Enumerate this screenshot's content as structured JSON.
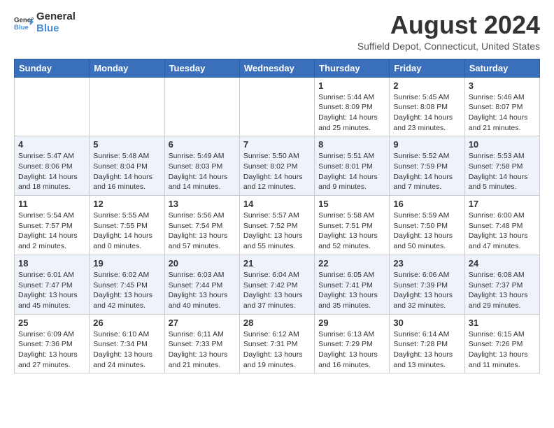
{
  "header": {
    "logo_line1": "General",
    "logo_line2": "Blue",
    "month": "August 2024",
    "location": "Suffield Depot, Connecticut, United States"
  },
  "weekdays": [
    "Sunday",
    "Monday",
    "Tuesday",
    "Wednesday",
    "Thursday",
    "Friday",
    "Saturday"
  ],
  "weeks": [
    [
      {
        "day": "",
        "info": ""
      },
      {
        "day": "",
        "info": ""
      },
      {
        "day": "",
        "info": ""
      },
      {
        "day": "",
        "info": ""
      },
      {
        "day": "1",
        "info": "Sunrise: 5:44 AM\nSunset: 8:09 PM\nDaylight: 14 hours\nand 25 minutes."
      },
      {
        "day": "2",
        "info": "Sunrise: 5:45 AM\nSunset: 8:08 PM\nDaylight: 14 hours\nand 23 minutes."
      },
      {
        "day": "3",
        "info": "Sunrise: 5:46 AM\nSunset: 8:07 PM\nDaylight: 14 hours\nand 21 minutes."
      }
    ],
    [
      {
        "day": "4",
        "info": "Sunrise: 5:47 AM\nSunset: 8:06 PM\nDaylight: 14 hours\nand 18 minutes."
      },
      {
        "day": "5",
        "info": "Sunrise: 5:48 AM\nSunset: 8:04 PM\nDaylight: 14 hours\nand 16 minutes."
      },
      {
        "day": "6",
        "info": "Sunrise: 5:49 AM\nSunset: 8:03 PM\nDaylight: 14 hours\nand 14 minutes."
      },
      {
        "day": "7",
        "info": "Sunrise: 5:50 AM\nSunset: 8:02 PM\nDaylight: 14 hours\nand 12 minutes."
      },
      {
        "day": "8",
        "info": "Sunrise: 5:51 AM\nSunset: 8:01 PM\nDaylight: 14 hours\nand 9 minutes."
      },
      {
        "day": "9",
        "info": "Sunrise: 5:52 AM\nSunset: 7:59 PM\nDaylight: 14 hours\nand 7 minutes."
      },
      {
        "day": "10",
        "info": "Sunrise: 5:53 AM\nSunset: 7:58 PM\nDaylight: 14 hours\nand 5 minutes."
      }
    ],
    [
      {
        "day": "11",
        "info": "Sunrise: 5:54 AM\nSunset: 7:57 PM\nDaylight: 14 hours\nand 2 minutes."
      },
      {
        "day": "12",
        "info": "Sunrise: 5:55 AM\nSunset: 7:55 PM\nDaylight: 14 hours\nand 0 minutes."
      },
      {
        "day": "13",
        "info": "Sunrise: 5:56 AM\nSunset: 7:54 PM\nDaylight: 13 hours\nand 57 minutes."
      },
      {
        "day": "14",
        "info": "Sunrise: 5:57 AM\nSunset: 7:52 PM\nDaylight: 13 hours\nand 55 minutes."
      },
      {
        "day": "15",
        "info": "Sunrise: 5:58 AM\nSunset: 7:51 PM\nDaylight: 13 hours\nand 52 minutes."
      },
      {
        "day": "16",
        "info": "Sunrise: 5:59 AM\nSunset: 7:50 PM\nDaylight: 13 hours\nand 50 minutes."
      },
      {
        "day": "17",
        "info": "Sunrise: 6:00 AM\nSunset: 7:48 PM\nDaylight: 13 hours\nand 47 minutes."
      }
    ],
    [
      {
        "day": "18",
        "info": "Sunrise: 6:01 AM\nSunset: 7:47 PM\nDaylight: 13 hours\nand 45 minutes."
      },
      {
        "day": "19",
        "info": "Sunrise: 6:02 AM\nSunset: 7:45 PM\nDaylight: 13 hours\nand 42 minutes."
      },
      {
        "day": "20",
        "info": "Sunrise: 6:03 AM\nSunset: 7:44 PM\nDaylight: 13 hours\nand 40 minutes."
      },
      {
        "day": "21",
        "info": "Sunrise: 6:04 AM\nSunset: 7:42 PM\nDaylight: 13 hours\nand 37 minutes."
      },
      {
        "day": "22",
        "info": "Sunrise: 6:05 AM\nSunset: 7:41 PM\nDaylight: 13 hours\nand 35 minutes."
      },
      {
        "day": "23",
        "info": "Sunrise: 6:06 AM\nSunset: 7:39 PM\nDaylight: 13 hours\nand 32 minutes."
      },
      {
        "day": "24",
        "info": "Sunrise: 6:08 AM\nSunset: 7:37 PM\nDaylight: 13 hours\nand 29 minutes."
      }
    ],
    [
      {
        "day": "25",
        "info": "Sunrise: 6:09 AM\nSunset: 7:36 PM\nDaylight: 13 hours\nand 27 minutes."
      },
      {
        "day": "26",
        "info": "Sunrise: 6:10 AM\nSunset: 7:34 PM\nDaylight: 13 hours\nand 24 minutes."
      },
      {
        "day": "27",
        "info": "Sunrise: 6:11 AM\nSunset: 7:33 PM\nDaylight: 13 hours\nand 21 minutes."
      },
      {
        "day": "28",
        "info": "Sunrise: 6:12 AM\nSunset: 7:31 PM\nDaylight: 13 hours\nand 19 minutes."
      },
      {
        "day": "29",
        "info": "Sunrise: 6:13 AM\nSunset: 7:29 PM\nDaylight: 13 hours\nand 16 minutes."
      },
      {
        "day": "30",
        "info": "Sunrise: 6:14 AM\nSunset: 7:28 PM\nDaylight: 13 hours\nand 13 minutes."
      },
      {
        "day": "31",
        "info": "Sunrise: 6:15 AM\nSunset: 7:26 PM\nDaylight: 13 hours\nand 11 minutes."
      }
    ]
  ]
}
